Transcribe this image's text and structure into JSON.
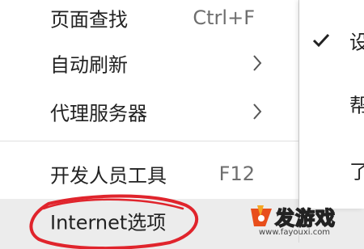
{
  "menu": {
    "items": [
      {
        "label": "页面查找",
        "shortcut": "Ctrl+F",
        "has_submenu": false
      },
      {
        "label": "自动刷新",
        "shortcut": "",
        "has_submenu": true
      },
      {
        "label": "代理服务器",
        "shortcut": "",
        "has_submenu": true
      },
      {
        "label": "开发人员工具",
        "shortcut": "F12",
        "has_submenu": false
      },
      {
        "label": "Internet选项",
        "shortcut": "",
        "has_submenu": false,
        "highlighted": true
      }
    ]
  },
  "side_menu": {
    "items": [
      {
        "label": "设",
        "checked": true
      },
      {
        "label": "帮",
        "checked": false
      },
      {
        "label": "了",
        "checked": false
      }
    ]
  },
  "annotation": {
    "color": "#e0242c"
  },
  "watermark": {
    "title": "发游戏",
    "url": "www.fayouxi.com",
    "logo": "fayouxi-logo"
  }
}
